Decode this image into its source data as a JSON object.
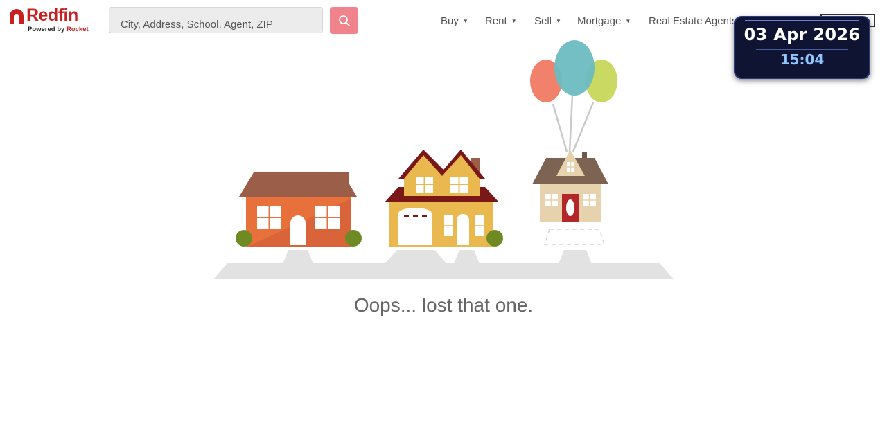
{
  "brand": {
    "name": "Redfin",
    "tagline_prefix": "Powered by",
    "tagline_brand": "Rocket",
    "color": "#c82021"
  },
  "search": {
    "placeholder": "City, Address, School, Agent, ZIP",
    "button_icon": "search-icon",
    "button_color": "#f0838b"
  },
  "nav": {
    "items": [
      {
        "label": "Buy",
        "has_dropdown": true
      },
      {
        "label": "Rent",
        "has_dropdown": true
      },
      {
        "label": "Sell",
        "has_dropdown": true
      },
      {
        "label": "Mortgage",
        "has_dropdown": true
      },
      {
        "label": "Real Estate Agents",
        "has_dropdown": false
      }
    ],
    "caret": "▼"
  },
  "clock_overlay": {
    "date": "03 Apr 2026",
    "time": "15:04"
  },
  "error": {
    "message": "Oops... lost that one."
  },
  "colors": {
    "balloon_red": "#f07a63",
    "balloon_teal": "#6bbcc0",
    "balloon_green": "#c7d75a",
    "house_orange": "#e8703a",
    "house_yellow": "#e9b94f",
    "house_beige": "#e6d3ae",
    "ground": "#e2e2e2"
  }
}
